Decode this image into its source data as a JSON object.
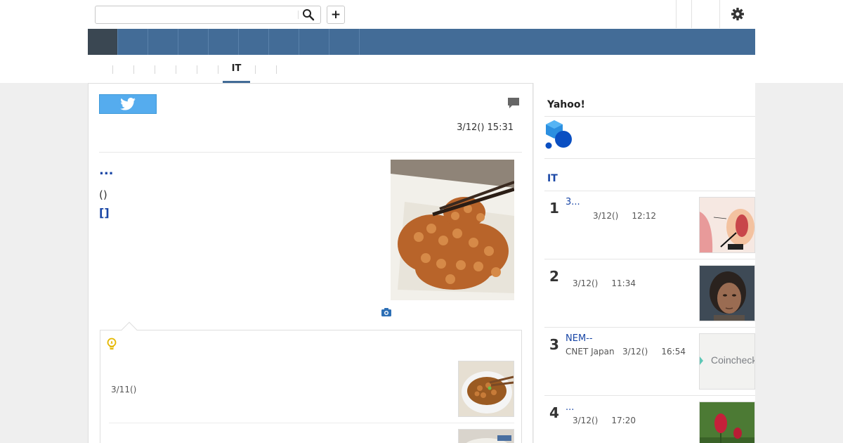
{
  "header": {
    "search": {
      "value": "",
      "placeholder": ""
    },
    "plus_label": "+"
  },
  "tabs": {
    "active_label": "IT"
  },
  "article": {
    "date": "3/12() 15:31",
    "headline": "...",
    "paren_text": "()",
    "bracket_text": "[]"
  },
  "related": {
    "date": "3/11()"
  },
  "sidebar": {
    "title": "Yahoo!",
    "category": "IT",
    "ranking": [
      {
        "rank": "1",
        "title": "3...",
        "meta": "3/12()     12:12"
      },
      {
        "rank": "2",
        "title": "",
        "meta": "3/12()     11:34"
      },
      {
        "rank": "3",
        "title": "NEM--",
        "meta": "CNET Japan   3/12()     16:54"
      },
      {
        "rank": "4",
        "title": "...",
        "meta": "3/12()     17:20"
      }
    ],
    "thumb3_text": "Coincheck"
  },
  "colors": {
    "nav": "#436c97",
    "nav_active": "#3a4752",
    "link": "#1a47a6",
    "twitter": "#55acee"
  }
}
